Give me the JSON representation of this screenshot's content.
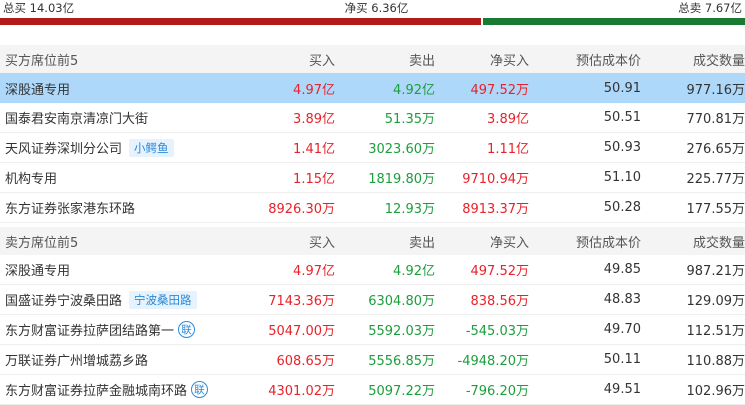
{
  "summary": {
    "total_buy": "总买 14.03亿",
    "net_buy": "净买 6.36亿",
    "total_sell": "总卖 7.67亿"
  },
  "colors": {
    "buy_bar": "#b31b1b",
    "sell_bar": "#1a7a34",
    "positive": "#e8222a",
    "negative": "#1c9e3c",
    "highlight_row": "#aed8fa",
    "tag": "#2b8ad8"
  },
  "bar": {
    "buy_fraction": 0.646
  },
  "buy_section": {
    "headers": [
      "买方席位前5",
      "买入",
      "卖出",
      "净买入",
      "预估成本价",
      "成交数量"
    ],
    "rows": [
      {
        "name": "深股通专用",
        "buy": "4.97亿",
        "sell": "4.92亿",
        "net": "497.52万",
        "cost": "50.91",
        "volume": "977.16万"
      },
      {
        "name": "国泰君安南京清凉门大街",
        "buy": "3.89亿",
        "sell": "51.35万",
        "net": "3.89亿",
        "cost": "50.51",
        "volume": "770.81万"
      },
      {
        "name": "天风证券深圳分公司",
        "tag": "小鳄鱼",
        "buy": "1.41亿",
        "sell": "3023.60万",
        "net": "1.11亿",
        "cost": "50.93",
        "volume": "276.65万"
      },
      {
        "name": "机构专用",
        "buy": "1.15亿",
        "sell": "1819.80万",
        "net": "9710.94万",
        "cost": "51.10",
        "volume": "225.77万"
      },
      {
        "name": "东方证券张家港东环路",
        "buy": "8926.30万",
        "sell": "12.93万",
        "net": "8913.37万",
        "cost": "50.28",
        "volume": "177.55万"
      }
    ]
  },
  "sell_section": {
    "headers": [
      "卖方席位前5",
      "买入",
      "卖出",
      "净买入",
      "预估成本价",
      "成交数量"
    ],
    "rows": [
      {
        "name": "深股通专用",
        "buy": "4.97亿",
        "sell": "4.92亿",
        "net": "497.52万",
        "cost": "49.85",
        "volume": "987.21万"
      },
      {
        "name": "国盛证券宁波桑田路",
        "tag": "宁波桑田路",
        "buy": "7143.36万",
        "sell": "6304.80万",
        "net": "838.56万",
        "cost": "48.83",
        "volume": "129.09万"
      },
      {
        "name": "东方财富证券拉萨团结路第一",
        "badge": "联",
        "buy": "5047.00万",
        "sell": "5592.03万",
        "net": "-545.03万",
        "cost": "49.70",
        "volume": "112.51万"
      },
      {
        "name": "万联证券广州增城荔乡路",
        "buy": "608.65万",
        "sell": "5556.85万",
        "net": "-4948.20万",
        "cost": "50.11",
        "volume": "110.88万"
      },
      {
        "name": "东方财富证券拉萨金融城南环路",
        "badge": "联",
        "buy": "4301.02万",
        "sell": "5097.22万",
        "net": "-796.20万",
        "cost": "49.51",
        "volume": "102.96万"
      }
    ]
  }
}
